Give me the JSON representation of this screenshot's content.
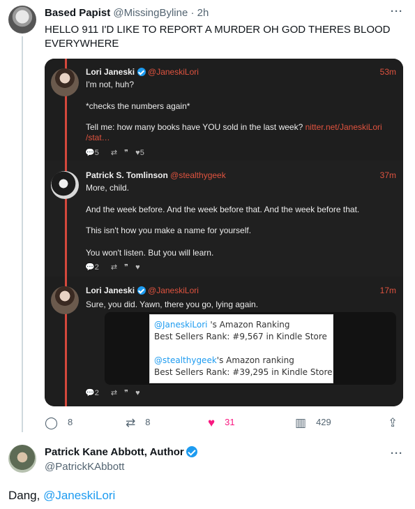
{
  "tweet": {
    "author_name": "Based Papist",
    "author_handle": "@MissingByline",
    "separator": "·",
    "time": "2h",
    "text": "HELLO 911 I'D LIKE TO REPORT A MURDER OH GOD THERES BLOOD EVERYWHERE",
    "more_icon": "more-icon"
  },
  "embedded": [
    {
      "name": "Lori Janeski",
      "handle": "@JaneskiLori",
      "time": "53m",
      "lines": [
        "I'm not, huh?",
        "*checks the numbers again*"
      ],
      "text_prefix": "Tell me: how many books have YOU sold in the last week? ",
      "link": "nitter.net/JaneskiLori",
      "link2": "/stat…",
      "stats": {
        "replies": "5",
        "retweets": "",
        "quotes": "",
        "likes": "5"
      }
    },
    {
      "name": "Patrick S. Tomlinson",
      "handle": "@stealthygeek",
      "time": "37m",
      "lines": [
        "More, child.",
        "And the week before. And the week before that. And the week before that.",
        "This isn't how you make a name for yourself.",
        "You won't listen. But you will learn."
      ],
      "stats": {
        "replies": "2",
        "retweets": "",
        "quotes": "",
        "likes": ""
      }
    },
    {
      "name": "Lori Janeski",
      "handle": "@JaneskiLori",
      "time": "17m",
      "lines": [
        "Sure, you did.  Yawn, there you go, lying again."
      ],
      "stats": {
        "replies": "2",
        "retweets": "",
        "quotes": "",
        "likes": ""
      }
    }
  ],
  "screenshot_embed": {
    "line1_link": "@JaneskiLori",
    "line1_text": " 's Amazon Ranking",
    "line2": "Best Sellers Rank: #9,567 in Kindle Store",
    "line3_link": "@stealthygeek",
    "line3_text": "'s Amazon ranking",
    "line4": "Best Sellers Rank: #39,295 in Kindle Store"
  },
  "actions": {
    "replies": "8",
    "retweets": "8",
    "likes": "31",
    "views": "429"
  },
  "reply": {
    "author_name": "Patrick Kane Abbott, Author",
    "author_handle": "@PatrickKAbbott",
    "text_prefix": "Dang, ",
    "mention": "@JaneskiLori"
  },
  "colors": {
    "accent_dark": "#e0533f",
    "blue": "#1d9bf0",
    "like_pink": "#f91880"
  }
}
